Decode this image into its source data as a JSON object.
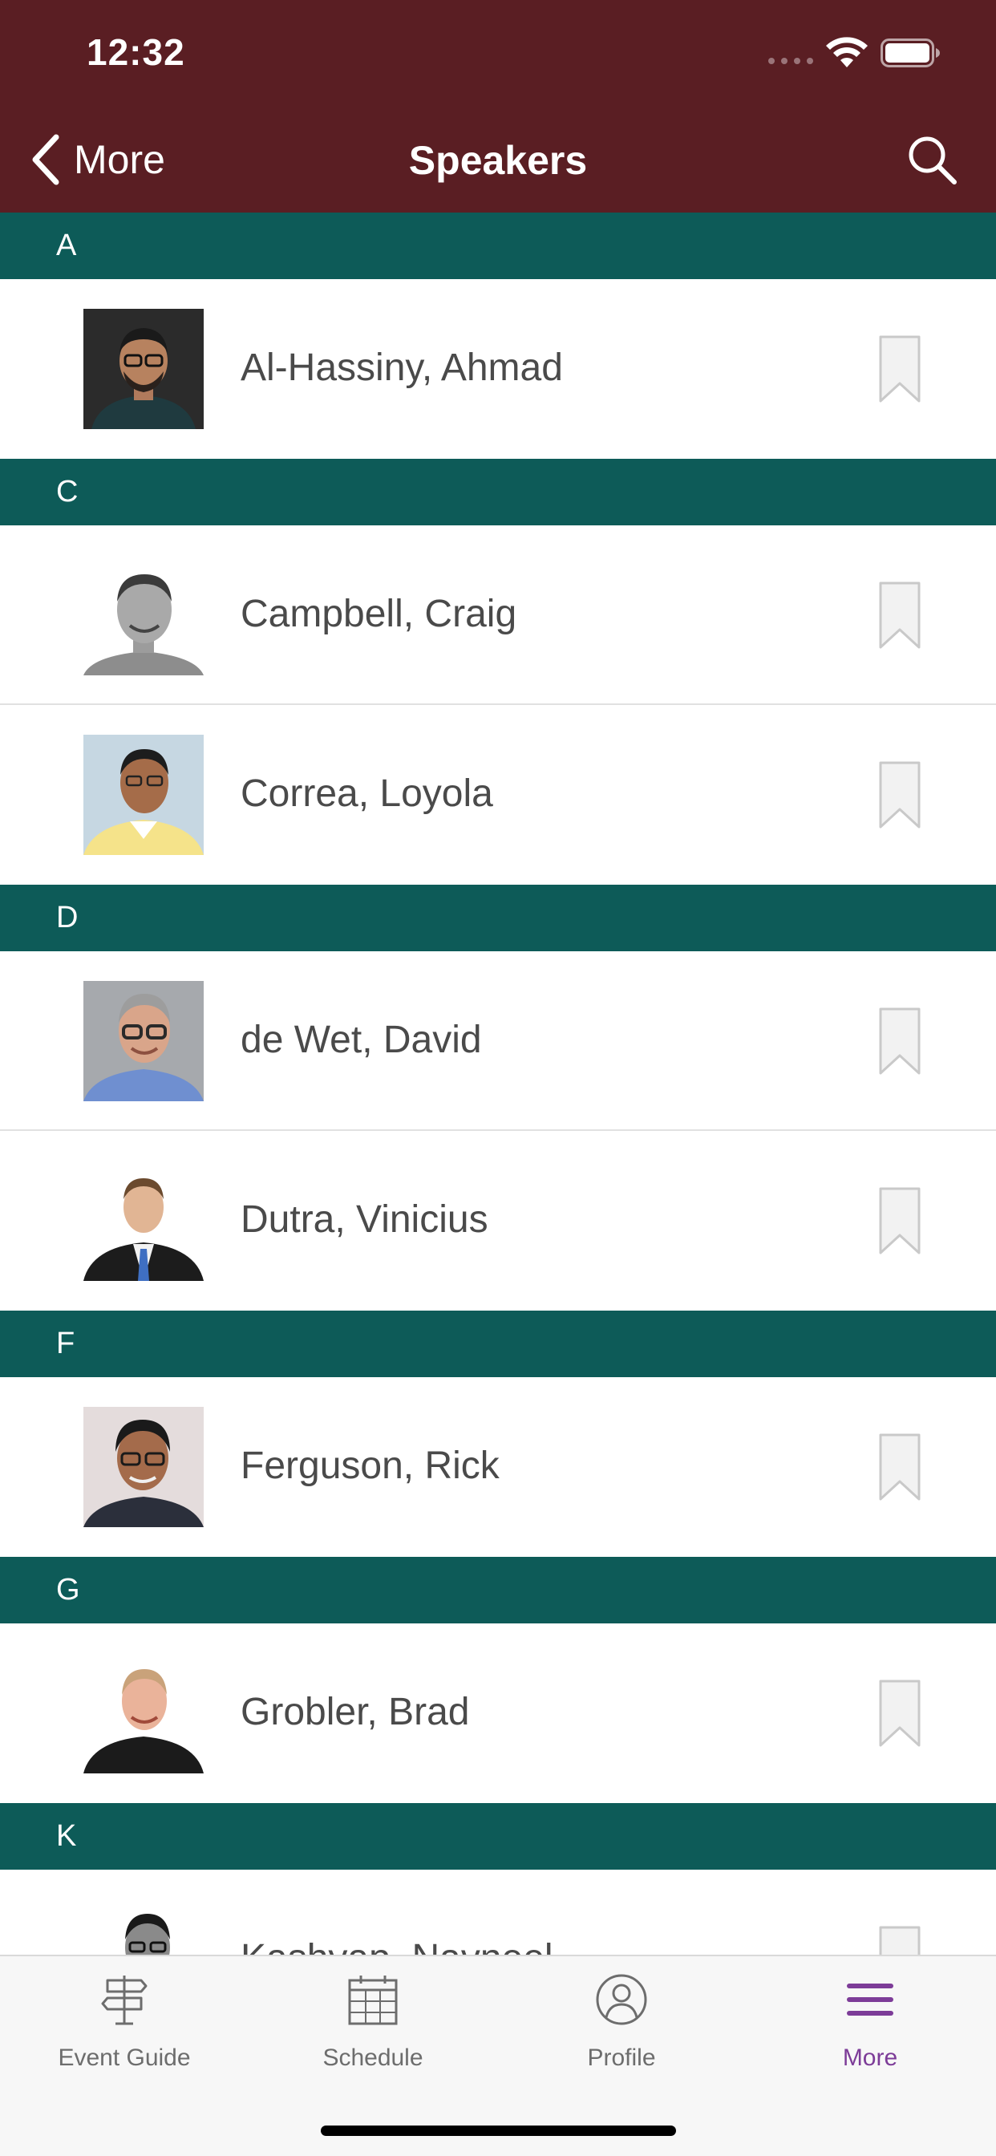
{
  "status": {
    "time": "12:32"
  },
  "nav": {
    "back_label": "More",
    "title": "Speakers"
  },
  "sections": [
    {
      "letter": "A",
      "speakers": [
        "Al-Hassiny, Ahmad"
      ]
    },
    {
      "letter": "C",
      "speakers": [
        "Campbell, Craig",
        "Correa, Loyola"
      ]
    },
    {
      "letter": "D",
      "speakers": [
        "de Wet, David",
        "Dutra, Vinicius"
      ]
    },
    {
      "letter": "F",
      "speakers": [
        "Ferguson, Rick"
      ]
    },
    {
      "letter": "G",
      "speakers": [
        "Grobler, Brad"
      ]
    },
    {
      "letter": "K",
      "speakers": [
        "Kashyap, Navneel"
      ]
    }
  ],
  "tabs": [
    {
      "label": "Event Guide",
      "icon": "signpost-icon"
    },
    {
      "label": "Schedule",
      "icon": "calendar-icon"
    },
    {
      "label": "Profile",
      "icon": "person-icon"
    },
    {
      "label": "More",
      "icon": "menu-icon"
    }
  ],
  "colors": {
    "nav": "#5a1e23",
    "section": "#0d5b58",
    "active_tab": "#7d3c98"
  }
}
